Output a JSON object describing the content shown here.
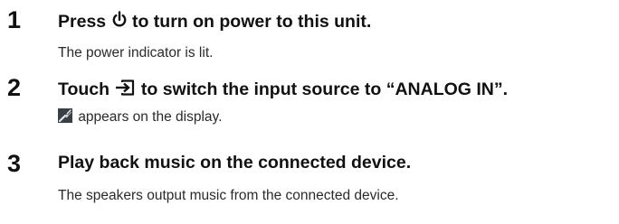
{
  "steps": [
    {
      "number": "1",
      "heading_before": "Press",
      "heading_icon": "power-icon",
      "heading_after": "to turn on power to this unit.",
      "sub_before": "",
      "sub_icon": "",
      "sub_text": "The power indicator is lit."
    },
    {
      "number": "2",
      "heading_before": "Touch",
      "heading_icon": "input-source-icon",
      "heading_after": "to switch the input source to “ANALOG IN”.",
      "sub_icon": "analog-in-display-icon",
      "sub_text": "appears on the display."
    },
    {
      "number": "3",
      "heading_before": "Play back music on the connected device.",
      "heading_icon": "",
      "heading_after": "",
      "sub_icon": "",
      "sub_text": "The speakers output music from the connected device."
    }
  ]
}
